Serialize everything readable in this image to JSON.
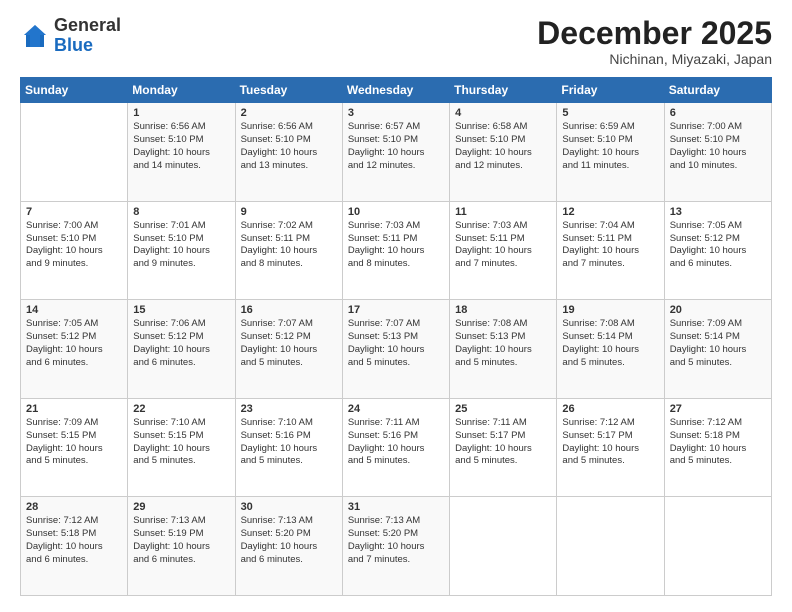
{
  "header": {
    "logo": {
      "general": "General",
      "blue": "Blue"
    },
    "title": "December 2025",
    "location": "Nichinan, Miyazaki, Japan"
  },
  "calendar": {
    "days_of_week": [
      "Sunday",
      "Monday",
      "Tuesday",
      "Wednesday",
      "Thursday",
      "Friday",
      "Saturday"
    ],
    "weeks": [
      [
        {
          "day": "",
          "info": ""
        },
        {
          "day": "1",
          "info": "Sunrise: 6:56 AM\nSunset: 5:10 PM\nDaylight: 10 hours\nand 14 minutes."
        },
        {
          "day": "2",
          "info": "Sunrise: 6:56 AM\nSunset: 5:10 PM\nDaylight: 10 hours\nand 13 minutes."
        },
        {
          "day": "3",
          "info": "Sunrise: 6:57 AM\nSunset: 5:10 PM\nDaylight: 10 hours\nand 12 minutes."
        },
        {
          "day": "4",
          "info": "Sunrise: 6:58 AM\nSunset: 5:10 PM\nDaylight: 10 hours\nand 12 minutes."
        },
        {
          "day": "5",
          "info": "Sunrise: 6:59 AM\nSunset: 5:10 PM\nDaylight: 10 hours\nand 11 minutes."
        },
        {
          "day": "6",
          "info": "Sunrise: 7:00 AM\nSunset: 5:10 PM\nDaylight: 10 hours\nand 10 minutes."
        }
      ],
      [
        {
          "day": "7",
          "info": "Sunrise: 7:00 AM\nSunset: 5:10 PM\nDaylight: 10 hours\nand 9 minutes."
        },
        {
          "day": "8",
          "info": "Sunrise: 7:01 AM\nSunset: 5:10 PM\nDaylight: 10 hours\nand 9 minutes."
        },
        {
          "day": "9",
          "info": "Sunrise: 7:02 AM\nSunset: 5:11 PM\nDaylight: 10 hours\nand 8 minutes."
        },
        {
          "day": "10",
          "info": "Sunrise: 7:03 AM\nSunset: 5:11 PM\nDaylight: 10 hours\nand 8 minutes."
        },
        {
          "day": "11",
          "info": "Sunrise: 7:03 AM\nSunset: 5:11 PM\nDaylight: 10 hours\nand 7 minutes."
        },
        {
          "day": "12",
          "info": "Sunrise: 7:04 AM\nSunset: 5:11 PM\nDaylight: 10 hours\nand 7 minutes."
        },
        {
          "day": "13",
          "info": "Sunrise: 7:05 AM\nSunset: 5:12 PM\nDaylight: 10 hours\nand 6 minutes."
        }
      ],
      [
        {
          "day": "14",
          "info": "Sunrise: 7:05 AM\nSunset: 5:12 PM\nDaylight: 10 hours\nand 6 minutes."
        },
        {
          "day": "15",
          "info": "Sunrise: 7:06 AM\nSunset: 5:12 PM\nDaylight: 10 hours\nand 6 minutes."
        },
        {
          "day": "16",
          "info": "Sunrise: 7:07 AM\nSunset: 5:12 PM\nDaylight: 10 hours\nand 5 minutes."
        },
        {
          "day": "17",
          "info": "Sunrise: 7:07 AM\nSunset: 5:13 PM\nDaylight: 10 hours\nand 5 minutes."
        },
        {
          "day": "18",
          "info": "Sunrise: 7:08 AM\nSunset: 5:13 PM\nDaylight: 10 hours\nand 5 minutes."
        },
        {
          "day": "19",
          "info": "Sunrise: 7:08 AM\nSunset: 5:14 PM\nDaylight: 10 hours\nand 5 minutes."
        },
        {
          "day": "20",
          "info": "Sunrise: 7:09 AM\nSunset: 5:14 PM\nDaylight: 10 hours\nand 5 minutes."
        }
      ],
      [
        {
          "day": "21",
          "info": "Sunrise: 7:09 AM\nSunset: 5:15 PM\nDaylight: 10 hours\nand 5 minutes."
        },
        {
          "day": "22",
          "info": "Sunrise: 7:10 AM\nSunset: 5:15 PM\nDaylight: 10 hours\nand 5 minutes."
        },
        {
          "day": "23",
          "info": "Sunrise: 7:10 AM\nSunset: 5:16 PM\nDaylight: 10 hours\nand 5 minutes."
        },
        {
          "day": "24",
          "info": "Sunrise: 7:11 AM\nSunset: 5:16 PM\nDaylight: 10 hours\nand 5 minutes."
        },
        {
          "day": "25",
          "info": "Sunrise: 7:11 AM\nSunset: 5:17 PM\nDaylight: 10 hours\nand 5 minutes."
        },
        {
          "day": "26",
          "info": "Sunrise: 7:12 AM\nSunset: 5:17 PM\nDaylight: 10 hours\nand 5 minutes."
        },
        {
          "day": "27",
          "info": "Sunrise: 7:12 AM\nSunset: 5:18 PM\nDaylight: 10 hours\nand 5 minutes."
        }
      ],
      [
        {
          "day": "28",
          "info": "Sunrise: 7:12 AM\nSunset: 5:18 PM\nDaylight: 10 hours\nand 6 minutes."
        },
        {
          "day": "29",
          "info": "Sunrise: 7:13 AM\nSunset: 5:19 PM\nDaylight: 10 hours\nand 6 minutes."
        },
        {
          "day": "30",
          "info": "Sunrise: 7:13 AM\nSunset: 5:20 PM\nDaylight: 10 hours\nand 6 minutes."
        },
        {
          "day": "31",
          "info": "Sunrise: 7:13 AM\nSunset: 5:20 PM\nDaylight: 10 hours\nand 7 minutes."
        },
        {
          "day": "",
          "info": ""
        },
        {
          "day": "",
          "info": ""
        },
        {
          "day": "",
          "info": ""
        }
      ]
    ]
  }
}
